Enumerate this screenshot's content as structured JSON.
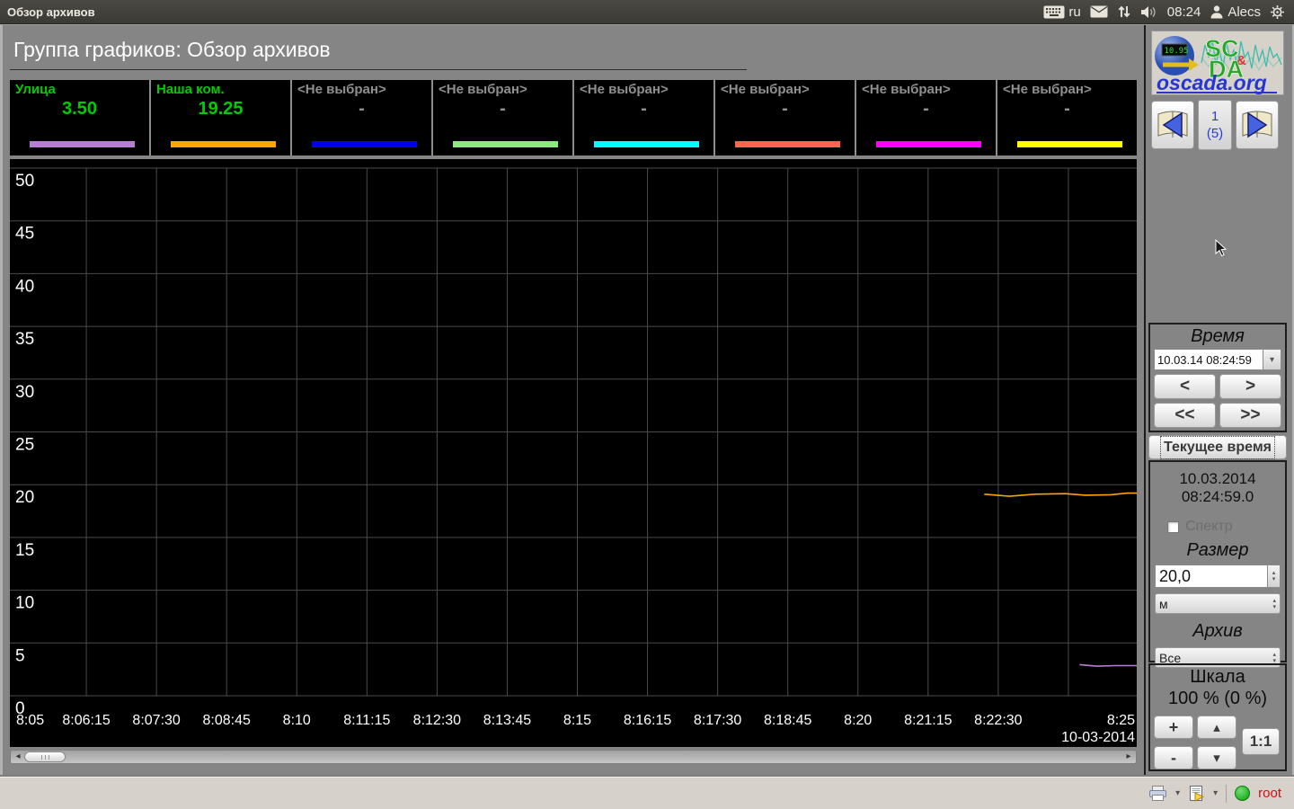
{
  "topbar": {
    "title": "Обзор архивов",
    "lang": "ru",
    "clock": "08:24",
    "user": "Alecs"
  },
  "header": {
    "title": "Группа графиков: Обзор архивов"
  },
  "legend": {
    "items": [
      {
        "label": "Улица",
        "value": "3.50",
        "color": "#b87fd0",
        "selected": true
      },
      {
        "label": "Наша ком.",
        "value": "19.25",
        "color": "#ffa500",
        "selected": true
      },
      {
        "label": "<Не выбран>",
        "value": "-",
        "color": "#0000ee",
        "selected": false
      },
      {
        "label": "<Не выбран>",
        "value": "-",
        "color": "#8ce87f",
        "selected": false
      },
      {
        "label": "<Не выбран>",
        "value": "-",
        "color": "#00ffff",
        "selected": false
      },
      {
        "label": "<Не выбран>",
        "value": "-",
        "color": "#fa6450",
        "selected": false
      },
      {
        "label": "<Не выбран>",
        "value": "-",
        "color": "#ff00ff",
        "selected": false
      },
      {
        "label": "<Не выбран>",
        "value": "-",
        "color": "#ffff00",
        "selected": false
      }
    ]
  },
  "chart_data": {
    "type": "line",
    "title": "",
    "xlabel": "",
    "ylabel": "",
    "ylim": [
      0,
      50
    ],
    "y_tick_step": 5,
    "x_minutes_range": [
      0,
      20
    ],
    "x_start_time": "8:05",
    "x_end_time": "8:25",
    "grid": true,
    "date_label": "10-03-2014",
    "x_ticks": [
      {
        "t": 0,
        "label": "8:05"
      },
      {
        "t": 1.25,
        "label": "8:06:15"
      },
      {
        "t": 2.5,
        "label": "8:07:30"
      },
      {
        "t": 3.75,
        "label": "8:08:45"
      },
      {
        "t": 5,
        "label": "8:10"
      },
      {
        "t": 6.25,
        "label": "8:11:15"
      },
      {
        "t": 7.5,
        "label": "8:12:30"
      },
      {
        "t": 8.75,
        "label": "8:13:45"
      },
      {
        "t": 10,
        "label": "8:15"
      },
      {
        "t": 11.25,
        "label": "8:16:15"
      },
      {
        "t": 12.5,
        "label": "8:17:30"
      },
      {
        "t": 13.75,
        "label": "8:18:45"
      },
      {
        "t": 15,
        "label": "8:20"
      },
      {
        "t": 16.25,
        "label": "8:21:15"
      },
      {
        "t": 17.5,
        "label": "8:22:30"
      },
      {
        "t": 20,
        "label": "8:25"
      }
    ],
    "series": [
      {
        "name": "Наша ком.",
        "color": "#ffa500",
        "points": [
          [
            17.25,
            19.1
          ],
          [
            17.7,
            18.9
          ],
          [
            18.15,
            19.1
          ],
          [
            18.7,
            19.15
          ],
          [
            19.05,
            19.0
          ],
          [
            19.5,
            19.05
          ],
          [
            19.8,
            19.2
          ],
          [
            20,
            19.2
          ]
        ]
      },
      {
        "name": "Улица",
        "color": "#b87fd0",
        "points": [
          [
            18.95,
            2.95
          ],
          [
            19.25,
            2.8
          ],
          [
            19.6,
            2.85
          ],
          [
            20,
            2.85
          ]
        ]
      }
    ]
  },
  "pager": {
    "current": "1",
    "total": "(5)"
  },
  "logo": {
    "sc": "SC",
    "amp": "&",
    "da": "DA",
    "site": "oscada.org",
    "display_value": "10.95"
  },
  "time_panel": {
    "title": "Время",
    "datetime": "10.03.14 08:24:59",
    "prev": "<",
    "next": ">",
    "prev_fast": "<<",
    "next_fast": ">>",
    "current_btn": "Текущее время",
    "date_line": "10.03.2014",
    "time_line": "08:24:59.0"
  },
  "spectrum": {
    "label": "Спектр",
    "checked": false
  },
  "size_panel": {
    "title": "Размер",
    "value": "20,0",
    "unit": "м"
  },
  "archive_panel": {
    "title": "Архив",
    "value": "Все"
  },
  "scale_panel": {
    "title": "Шкала",
    "value": "100 % (0 %)",
    "plus": "+",
    "minus": "-",
    "one_to_one": "1:1"
  },
  "statusbar": {
    "user": "root"
  },
  "glyphs": {
    "caret_down": "▾",
    "caret_up": "▴",
    "scroll_left": "◂",
    "scroll_right": "▸"
  },
  "icons": [
    "keyboard-icon",
    "mail-icon",
    "updown-arrows-icon",
    "volume-icon",
    "user-icon",
    "gear-icon",
    "book-prev-icon",
    "book-next-icon",
    "printer-icon",
    "export-doc-icon",
    "status-dot-icon"
  ]
}
